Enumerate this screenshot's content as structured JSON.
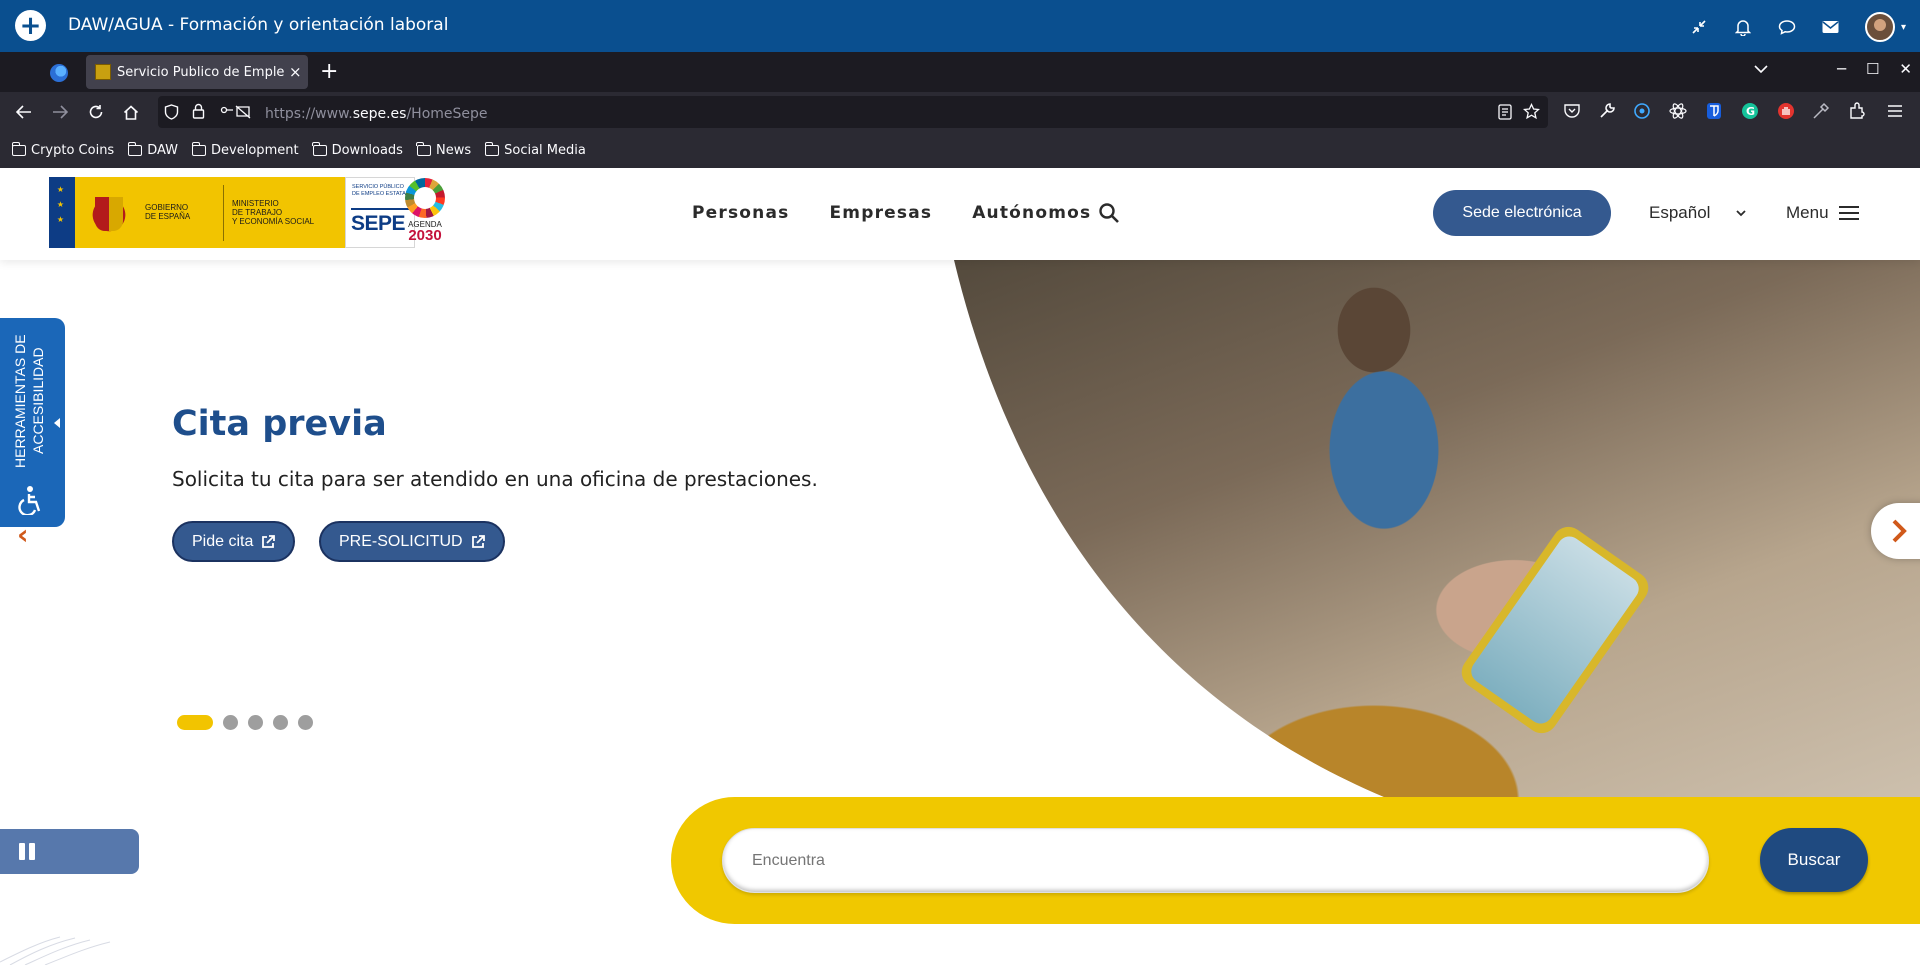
{
  "appbar": {
    "title": "DAW/AGUA - Formación y orientación laboral",
    "icons": [
      "collapse-icon",
      "bell-icon",
      "chat-icon",
      "mail-icon",
      "avatar"
    ]
  },
  "browser": {
    "tab": {
      "title": "Servicio Publico de Empleo",
      "close": "×"
    },
    "new_tab": "+",
    "url": {
      "prefix": "https://www.",
      "domain": "sepe.es",
      "path": "/HomeSepe"
    },
    "bookmarks": [
      "Crypto Coins",
      "DAW",
      "Development",
      "Downloads",
      "News",
      "Social Media"
    ]
  },
  "site": {
    "nav": [
      "Personas",
      "Empresas",
      "Autónomos"
    ],
    "sede_label": "Sede electrónica",
    "language": "Español",
    "menu_label": "Menu",
    "logo": {
      "gobierno": "GOBIERNO\nDE ESPAÑA",
      "ministerio": "MINISTERIO\nDE TRABAJO\nY ECONOMÍA SOCIAL",
      "sepe_small": "SERVICIO PÚBLICO\nDE EMPLEO ESTATAL",
      "sepe": "SEPE",
      "agenda": "AGENDA",
      "agenda_year": "2030"
    }
  },
  "hero": {
    "title": "Cita previa",
    "text": "Solicita tu cita para ser atendido en una oficina de prestaciones.",
    "buttons": [
      "Pide cita",
      "PRE-SOLICITUD"
    ],
    "slides_total": 5,
    "active_slide": 1
  },
  "accessibility": {
    "label": "HERRAMIENTAS DE ACCESIBILIDAD"
  },
  "search": {
    "placeholder": "Encuentra",
    "button": "Buscar"
  },
  "colors": {
    "appbar": "#0a4f8f",
    "brand_blue": "#34598f",
    "title_blue": "#1e4e8c",
    "yellow": "#f0c800",
    "arrow_orange": "#d0591a"
  }
}
